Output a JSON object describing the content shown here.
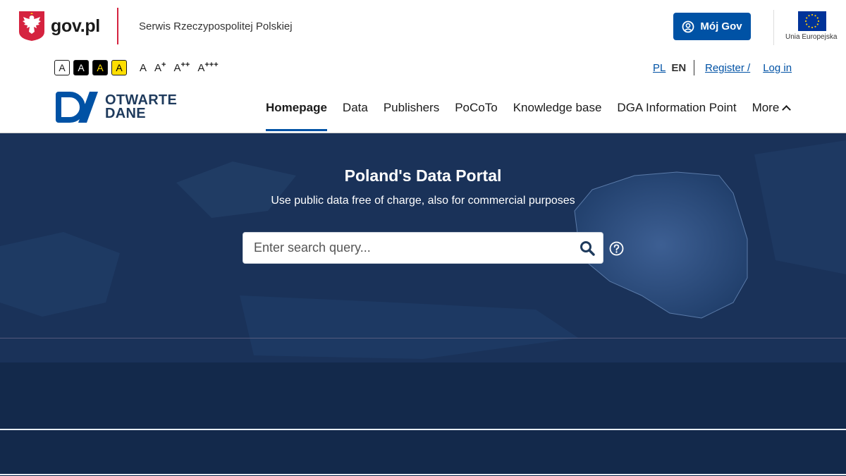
{
  "govbar": {
    "logo_text": "gov.pl",
    "service_name": "Serwis Rzeczypospolitej Polskiej",
    "login_button": "Mój Gov",
    "eu_label": "Unia Europejska"
  },
  "accessibility": {
    "contrast_options": [
      "A",
      "A",
      "A",
      "A"
    ],
    "font_sizes": [
      {
        "base": "A",
        "sup": ""
      },
      {
        "base": "A",
        "sup": "+"
      },
      {
        "base": "A",
        "sup": "++"
      },
      {
        "base": "A",
        "sup": "+++"
      }
    ]
  },
  "language": {
    "pl": "PL",
    "en": "EN"
  },
  "auth": {
    "register": "Register /",
    "login": "Log in"
  },
  "portal": {
    "logo_line1": "OTWARTE",
    "logo_line2": "DANE"
  },
  "nav": {
    "items": [
      "Homepage",
      "Data",
      "Publishers",
      "PoCoTo",
      "Knowledge base",
      "DGA Information Point",
      "More"
    ]
  },
  "hero": {
    "title": "Poland's Data Portal",
    "subtitle": "Use public data free of charge, also for commercial purposes",
    "search_placeholder": "Enter search query..."
  },
  "colors": {
    "brand_blue": "#0052a5",
    "hero_bg": "#13294b",
    "gov_red": "#d5233f"
  }
}
